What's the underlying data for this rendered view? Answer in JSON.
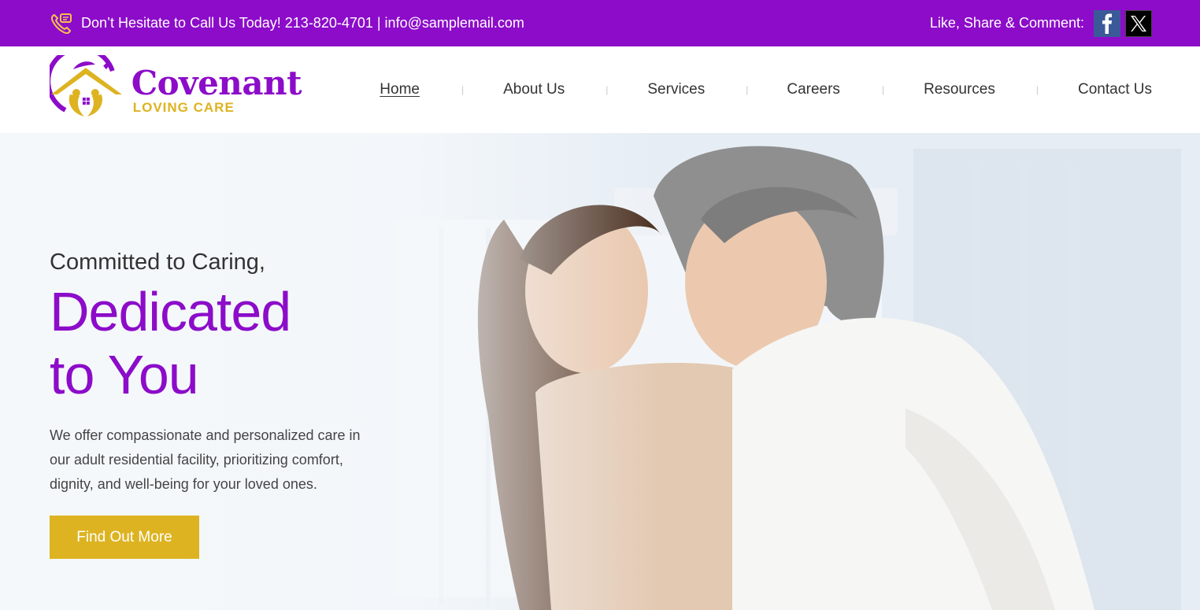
{
  "topbar": {
    "contact_text": "Don’t Hesitate to Call Us Today! 213-820-4701 | info@samplemail.com",
    "social_label": "Like, Share & Comment:",
    "icons": [
      "phone-chat-icon",
      "facebook-icon",
      "x-icon"
    ]
  },
  "logo": {
    "title": "Covenant",
    "subtitle": "LOVING CARE"
  },
  "nav": {
    "items": [
      {
        "label": "Home",
        "active": true
      },
      {
        "label": "About Us",
        "active": false
      },
      {
        "label": "Services",
        "active": false
      },
      {
        "label": "Careers",
        "active": false
      },
      {
        "label": "Resources",
        "active": false
      },
      {
        "label": "Contact Us",
        "active": false
      }
    ],
    "separator": "|"
  },
  "hero": {
    "kicker": "Committed to Caring,",
    "title_line1": "Dedicated",
    "title_line2": "to You",
    "description": "We offer compassionate and personalized care in our adult residential facility, prioritizing comfort, dignity, and well-being for your loved ones.",
    "button_label": "Find Out More"
  },
  "colors": {
    "brand_purple": "#8c0cc9",
    "accent_gold": "#ddb321",
    "facebook_blue": "#3b5998"
  }
}
